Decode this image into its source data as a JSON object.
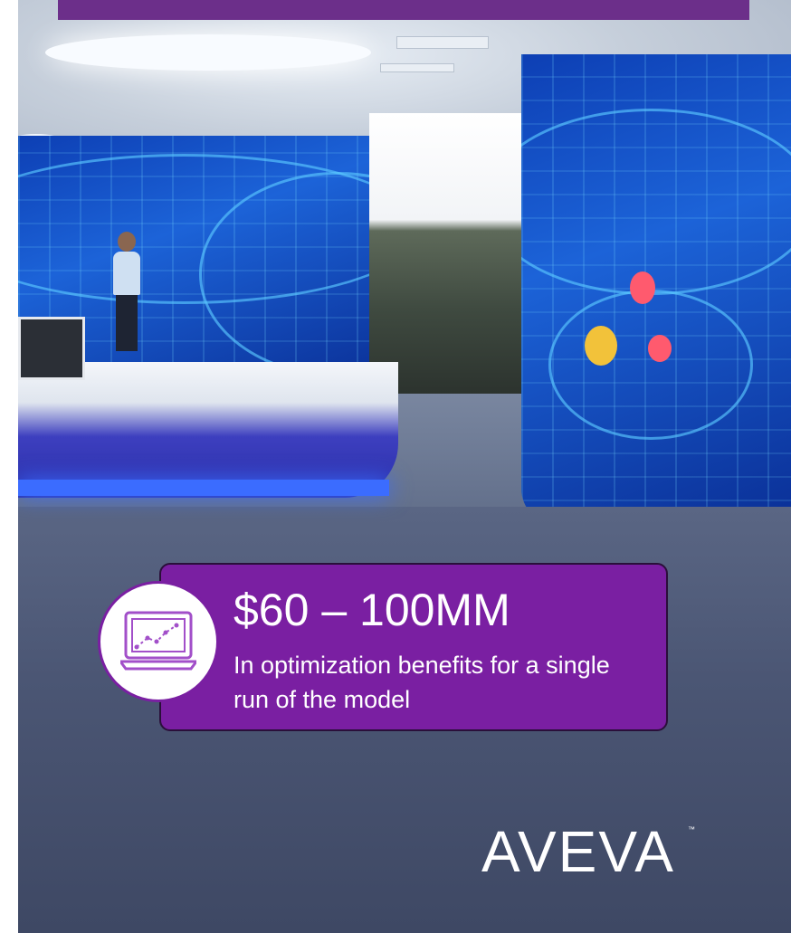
{
  "callout": {
    "value": "$60 – 100MM",
    "description": "In optimization benefits for a single run of the model",
    "icon": "laptop-chart-icon"
  },
  "brand": {
    "logo_text": "AVEVA",
    "trademark": "™"
  },
  "colors": {
    "accent_purple": "#7a1fa2",
    "banner_purple": "#6c2f8a",
    "screen_blue": "#1c63d8"
  }
}
